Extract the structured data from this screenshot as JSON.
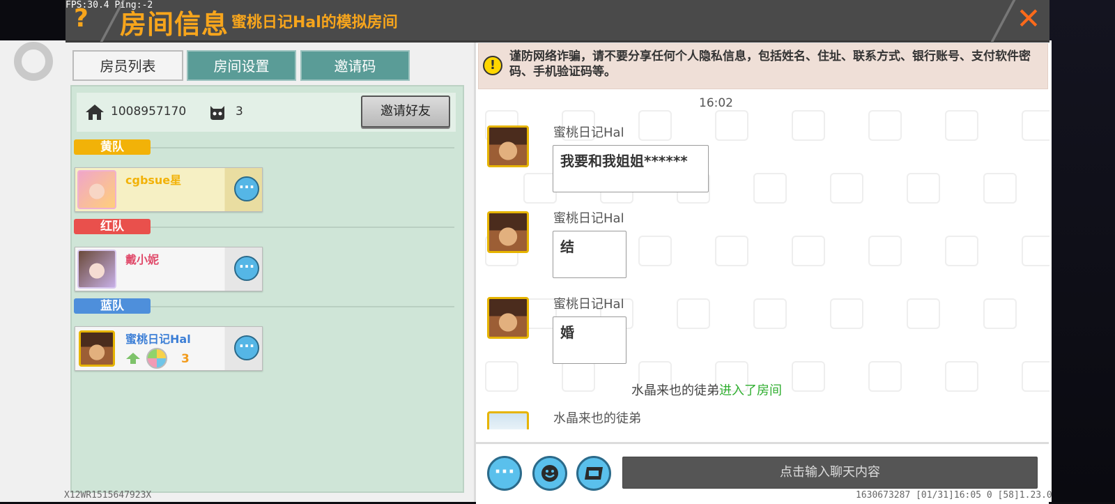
{
  "hud": {
    "fps": "FPS:30.4  Ping:-2"
  },
  "header": {
    "help_icon": "question-mark-icon",
    "title": "房间信息",
    "subtitle": "蜜桃日记Hal的模拟房间",
    "close_icon": "close-x-icon"
  },
  "tabs": [
    {
      "label": "房员列表",
      "active": true
    },
    {
      "label": "房间设置",
      "active": false
    },
    {
      "label": "邀请码",
      "active": false
    }
  ],
  "room": {
    "id": "1008957170",
    "player_count": "3",
    "invite_label": "邀请好友"
  },
  "teams": [
    {
      "name": "黄队",
      "color": "#f2b208",
      "members": [
        {
          "name": "cgbsue星",
          "name_color": "#f2b208",
          "card_bg": "#f6f0c4"
        }
      ]
    },
    {
      "name": "红队",
      "color": "#e9504c",
      "members": [
        {
          "name": "戴小妮",
          "name_color": "#e04a6a",
          "card_bg": "#f2f2f2"
        }
      ]
    },
    {
      "name": "蓝队",
      "color": "#4e8fdb",
      "members": [
        {
          "name": "蜜桃日记Hal",
          "name_color": "#3d7fd6",
          "card_bg": "#f2f2f2",
          "level": "3"
        }
      ]
    }
  ],
  "chat": {
    "warning": "谨防网络诈骗，请不要分享任何个人隐私信息，包括姓名、住址、联系方式、银行账号、支付软件密码、手机验证码等。",
    "time": "16:02",
    "messages": [
      {
        "sender": "蜜桃日记Hal",
        "text": "我要和我姐姐******"
      },
      {
        "sender": "蜜桃日记Hal",
        "text": "结"
      },
      {
        "sender": "蜜桃日记Hal",
        "text": "婚"
      }
    ],
    "system_user": "水晶来也的徒弟",
    "system_action": "进入了房间",
    "last_sender": "水晶来也的徒弟",
    "input_placeholder": "点击输入聊天内容"
  },
  "footer": {
    "left": "X12WR1515647923X",
    "right": "1630673287    [01/31]16:05 0   [58]1.23.0"
  }
}
